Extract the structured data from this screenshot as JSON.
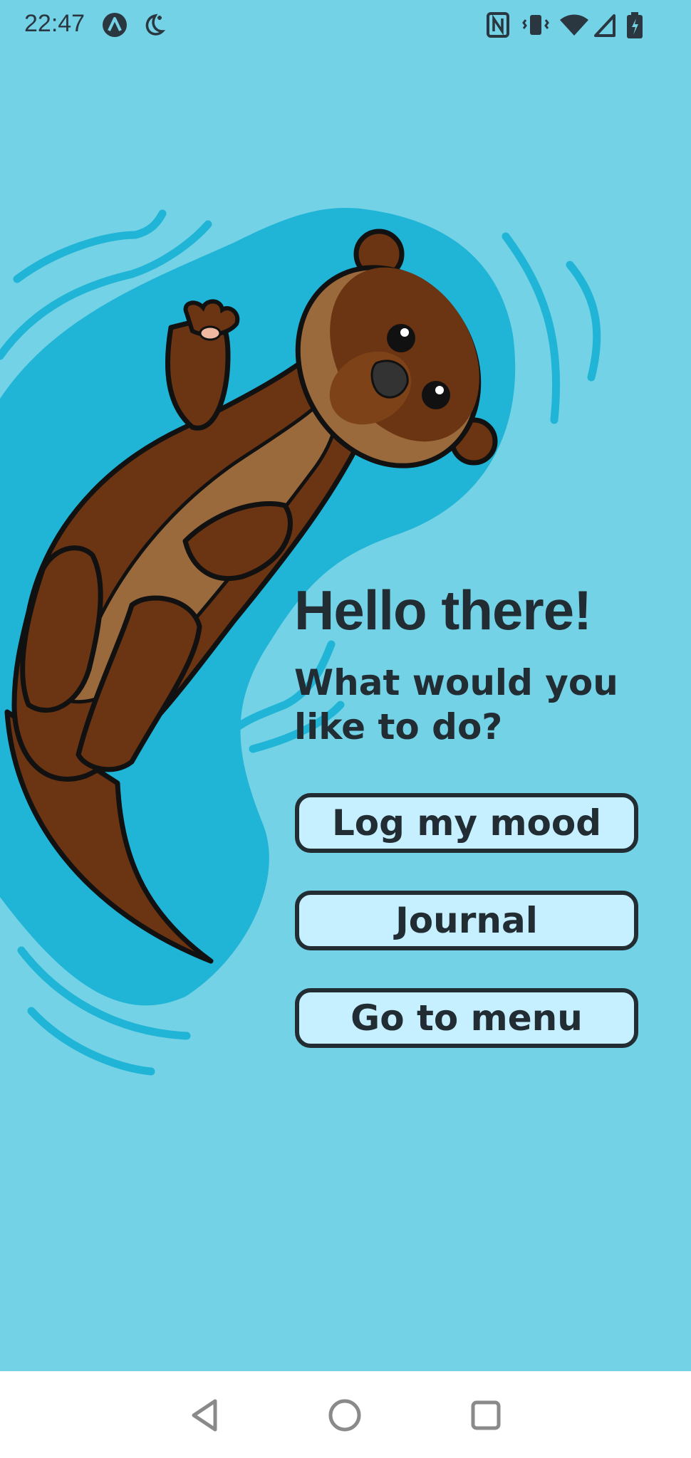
{
  "status_bar": {
    "time": "22:47",
    "left_icons": [
      "app-notification-icon",
      "do-not-disturb-moon-icon"
    ],
    "right_icons": [
      "nfc-icon",
      "vibrate-icon",
      "wifi-icon",
      "cell-signal-icon",
      "battery-charging-icon"
    ]
  },
  "main": {
    "greeting": "Hello there!",
    "prompt": "What would you like to do?",
    "buttons": {
      "log_mood": "Log my mood",
      "journal": "Journal",
      "go_to_menu": "Go to menu"
    }
  },
  "nav_bar": {
    "back": "back-triangle-icon",
    "home": "home-circle-icon",
    "recents": "recents-square-icon"
  },
  "colors": {
    "background": "#73d2e6",
    "water_blob": "#20b4d6",
    "button_fill": "#c6efff",
    "text_dark": "#222c33",
    "otter_dark": "#6b3412",
    "otter_light": "#9b6a3c"
  }
}
